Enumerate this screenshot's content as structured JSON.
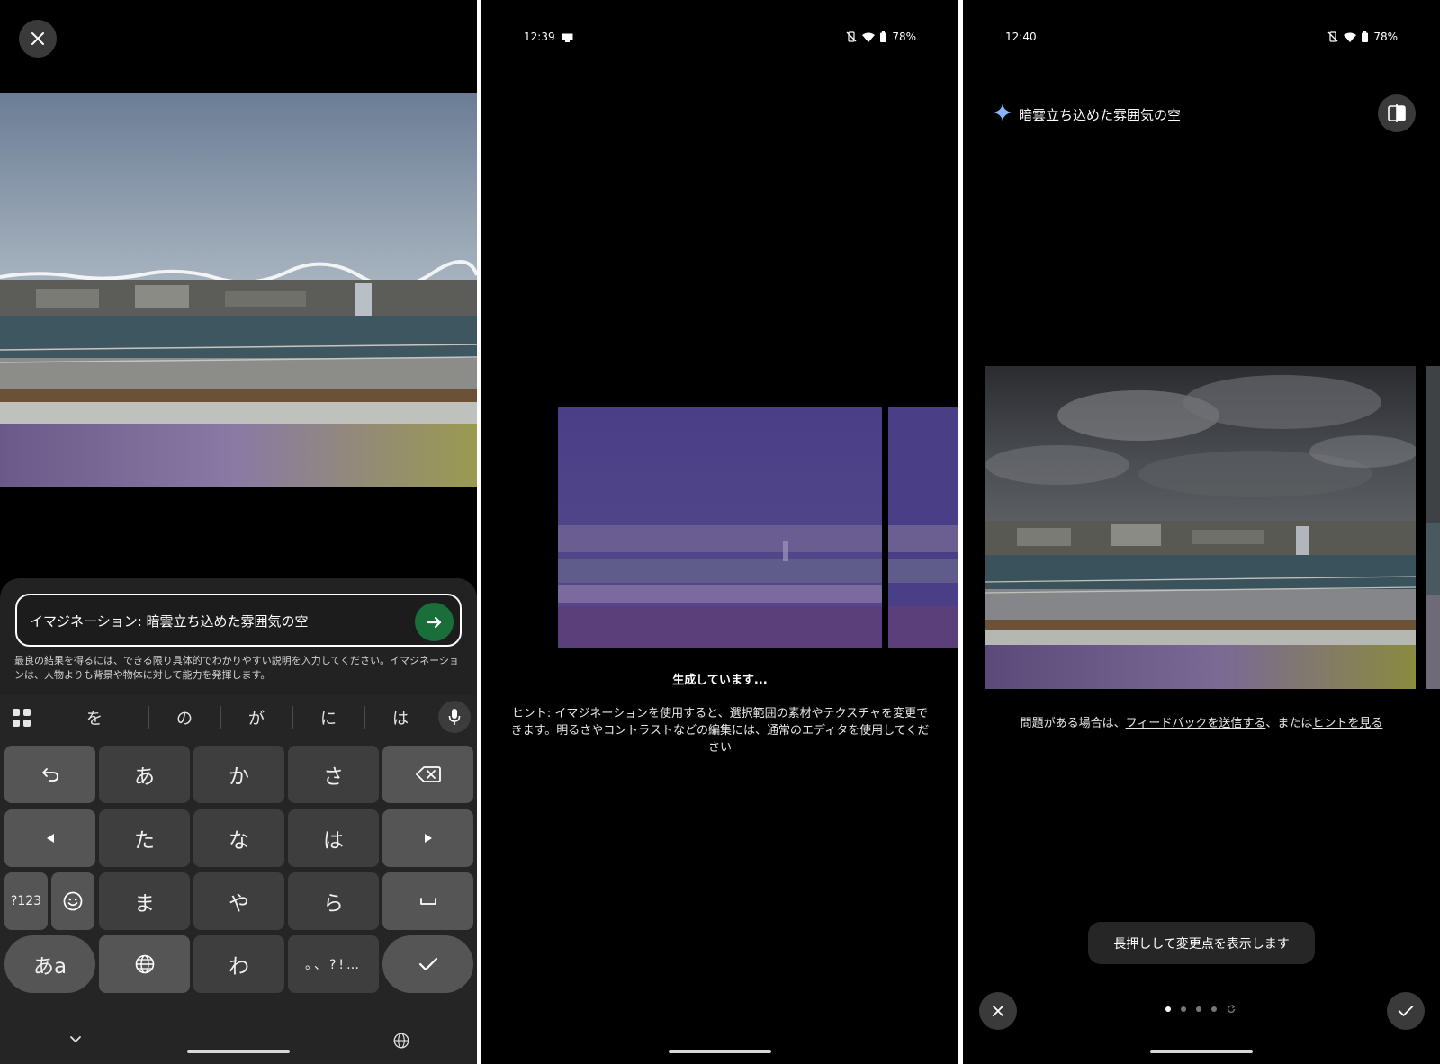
{
  "panel1": {
    "close_icon": "close-icon",
    "prompt": {
      "value": "イマジネーション: 暗雲立ち込めた雰囲気の空",
      "send_icon": "arrow-right-icon",
      "send_color": "#1a6e3a"
    },
    "helper_text": "最良の結果を得るには、できる限り具体的でわかりやすい説明を入力してください。イマジネーションは、人物よりも背景や物体に対して能力を発揮します。",
    "keyboard": {
      "suggestions": [
        "を",
        "の",
        "が",
        "に",
        "は"
      ],
      "row1": [
        "",
        "あ",
        "か",
        "さ",
        ""
      ],
      "row2": [
        "",
        "た",
        "な",
        "は",
        ""
      ],
      "row3": [
        "?123",
        "",
        "ま",
        "や",
        "ら",
        ""
      ],
      "row4": [
        "あa",
        "",
        "わ",
        "",
        ""
      ],
      "punct_key": "。、?!…"
    }
  },
  "panel2": {
    "status": {
      "time": "12:39",
      "battery": "78%"
    },
    "generating_label": "生成しています...",
    "hint_text": "ヒント: イマジネーションを使用すると、選択範囲の素材やテクスチャを変更できます。明るさやコントラストなどの編集には、通常のエディタを使用してください"
  },
  "panel3": {
    "status": {
      "time": "12:40",
      "battery": "78%"
    },
    "prompt_title": "暗雲立ち込めた雰囲気の空",
    "feedback_prefix": "問題がある場合は、",
    "feedback_link": "フィードバックを送信する",
    "feedback_mid": "、または",
    "hint_link": "ヒントを見る",
    "toast": "長押しして変更点を表示します",
    "page_dots": {
      "count": 4,
      "active": 1
    },
    "accent_color": "#8ab4f8"
  }
}
